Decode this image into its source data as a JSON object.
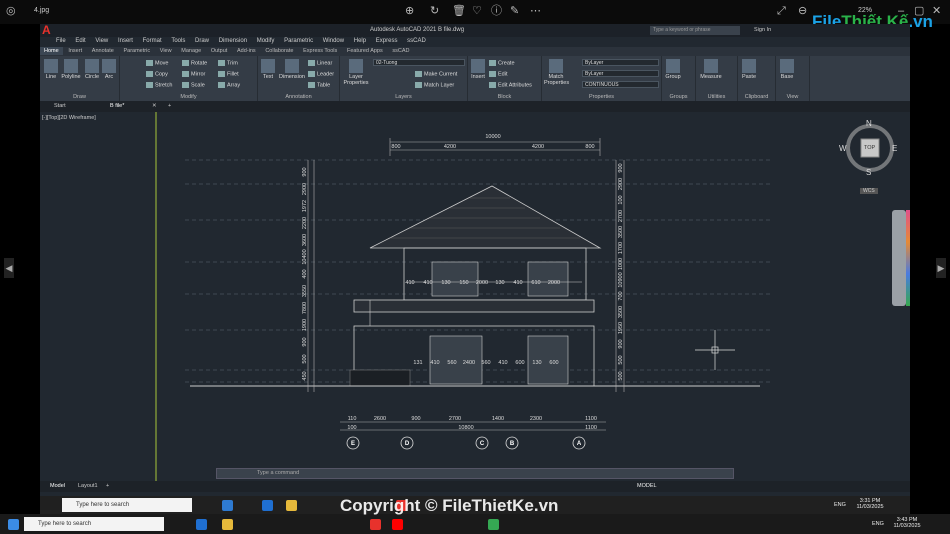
{
  "viewer": {
    "filename": "4.jpg",
    "zoom": "22%"
  },
  "app": {
    "title": "Autodesk AutoCAD 2021   B file.dwg",
    "search_placeholder": "Type a keyword or phrase",
    "sign_in": "Sign In",
    "menu": [
      "File",
      "Edit",
      "View",
      "Insert",
      "Format",
      "Tools",
      "Draw",
      "Dimension",
      "Modify",
      "Parametric",
      "Window",
      "Help",
      "Express",
      "ssCAD"
    ],
    "ribbon_tabs": [
      "Home",
      "Insert",
      "Annotate",
      "Parametric",
      "View",
      "Manage",
      "Output",
      "Add-ins",
      "Collaborate",
      "Express Tools",
      "Featured Apps",
      "ssCAD"
    ],
    "active_tab": "Home",
    "panels": {
      "draw": {
        "label": "Draw",
        "tools": [
          "Line",
          "Polyline",
          "Circle",
          "Arc"
        ]
      },
      "modify": {
        "label": "Modify",
        "tools": [
          "Move",
          "Rotate",
          "Trim",
          "Copy",
          "Mirror",
          "Fillet",
          "Stretch",
          "Scale",
          "Array"
        ]
      },
      "annotation": {
        "label": "Annotation",
        "tools": [
          "Text",
          "Dimension",
          "Linear",
          "Leader",
          "Table"
        ]
      },
      "layers": {
        "label": "Layers",
        "layer_props": "Layer Properties",
        "current_layer": "02-Tuong",
        "make_current": "Make Current",
        "match_layer": "Match Layer"
      },
      "block": {
        "label": "Block",
        "insert": "Insert",
        "create": "Create",
        "edit": "Edit",
        "edit_attr": "Edit Attributes"
      },
      "properties": {
        "label": "Properties",
        "match": "Match Properties",
        "color": "ByLayer",
        "linetype": "ByLayer",
        "lineweight": "CONTINUOUS"
      },
      "groups": {
        "label": "Groups",
        "group": "Group"
      },
      "utilities": {
        "label": "Utilities",
        "measure": "Measure"
      },
      "clipboard": {
        "label": "Clipboard",
        "paste": "Paste"
      },
      "view": {
        "label": "View",
        "base": "Base"
      }
    },
    "file_tabs": [
      "Start",
      "B file*"
    ],
    "viewport_label": "[-][Top][2D Wireframe]",
    "viewcube": {
      "n": "N",
      "s": "S",
      "e": "E",
      "w": "W",
      "top": "TOP",
      "wcs": "WCS"
    },
    "command_placeholder": "Type a command",
    "layout_tabs": [
      "Model",
      "Layout1"
    ],
    "status_model": "MODEL"
  },
  "drawing": {
    "top_total": "10000",
    "top_dims": [
      "800",
      "4200",
      "4200",
      "800"
    ],
    "bottom_dims": [
      "110",
      "2600",
      "900",
      "2700",
      "1400",
      "2300",
      "1100"
    ],
    "bottom_sub": [
      "100",
      "10800",
      "1100"
    ],
    "grid_labels": [
      "E",
      "D",
      "C",
      "B",
      "A"
    ],
    "left_dims": [
      "900",
      "2900",
      "1972",
      "2200",
      "3600",
      "10400",
      "400",
      "3550",
      "7800",
      "1900",
      "900",
      "500",
      "450"
    ],
    "right_dims": [
      "900",
      "2900",
      "100",
      "2700",
      "3500",
      "1700",
      "1000",
      "10900",
      "700",
      "3500",
      "1950",
      "900",
      "500",
      "500"
    ],
    "window_dims_upper": [
      "410",
      "410",
      "130",
      "150",
      "2000",
      "130",
      "410",
      "610",
      "2000"
    ],
    "window_dims_lower": [
      "131",
      "410",
      "560",
      "2400",
      "560",
      "410",
      "600",
      "130",
      "600"
    ]
  },
  "taskbar_inner": {
    "search": "Type here to search",
    "time": "3:31 PM",
    "date": "11/03/2025",
    "lang": "ENG"
  },
  "taskbar": {
    "search": "Type here to search",
    "time": "3:43 PM",
    "date": "11/03/2025",
    "lang": "ENG"
  },
  "watermark": "Copyright © FileThietKe.vn",
  "logo": {
    "part1": "File",
    "part2": "Thiết Kế",
    "part3": ".vn"
  }
}
